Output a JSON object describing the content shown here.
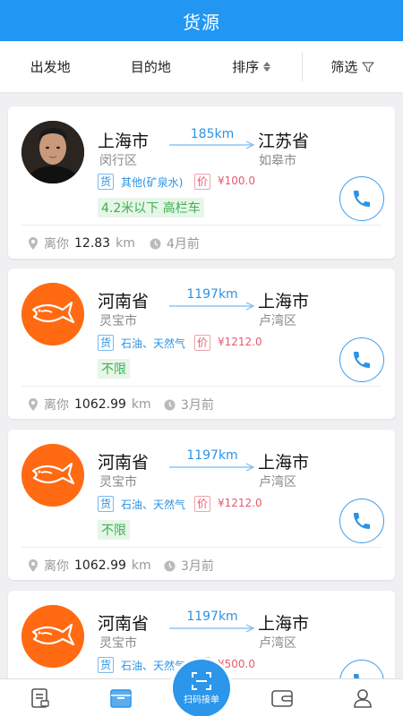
{
  "header": {
    "title": "货源"
  },
  "filters": [
    {
      "label": "出发地"
    },
    {
      "label": "目的地"
    },
    {
      "label": "排序"
    },
    {
      "label": "筛选"
    }
  ],
  "cards": [
    {
      "from_city": "上海市",
      "from_district": "闵行区",
      "distance": "185km",
      "to_city": "江苏省",
      "to_district": "如皋市",
      "goods_tag": "货",
      "goods": "其他(矿泉水)",
      "price_tag": "价",
      "price": "¥100.0",
      "truck": "4.2米以下 高栏车",
      "dist_prefix": "离你",
      "dist_value": "12.83",
      "dist_unit": "km",
      "time": "4月前",
      "avatar": "user-photo"
    },
    {
      "from_city": "河南省",
      "from_district": "灵宝市",
      "distance": "1197km",
      "to_city": "上海市",
      "to_district": "卢湾区",
      "goods_tag": "货",
      "goods": "石油、天然气",
      "price_tag": "价",
      "price": "¥1212.0",
      "truck": "不限",
      "dist_prefix": "离你",
      "dist_value": "1062.99",
      "dist_unit": "km",
      "time": "3月前",
      "avatar": "company-logo"
    },
    {
      "from_city": "河南省",
      "from_district": "灵宝市",
      "distance": "1197km",
      "to_city": "上海市",
      "to_district": "卢湾区",
      "goods_tag": "货",
      "goods": "石油、天然气",
      "price_tag": "价",
      "price": "¥1212.0",
      "truck": "不限",
      "dist_prefix": "离你",
      "dist_value": "1062.99",
      "dist_unit": "km",
      "time": "3月前",
      "avatar": "company-logo"
    },
    {
      "from_city": "河南省",
      "from_district": "灵宝市",
      "distance": "1197km",
      "to_city": "上海市",
      "to_district": "卢湾区",
      "goods_tag": "货",
      "goods": "石油、天然气",
      "price_tag": "价",
      "price": "¥500.0",
      "avatar": "company-logo"
    }
  ],
  "tabbar": {
    "scan_label": "扫码接单",
    "tabs": [
      {
        "icon": "document-list-icon"
      },
      {
        "icon": "cargo-box-icon"
      },
      {
        "icon": "wallet-icon"
      },
      {
        "icon": "user-icon"
      }
    ]
  },
  "colors": {
    "primary": "#2196f3",
    "price": "#e85a6c",
    "truck": "#3bb04f",
    "logo": "#ff6a13"
  }
}
